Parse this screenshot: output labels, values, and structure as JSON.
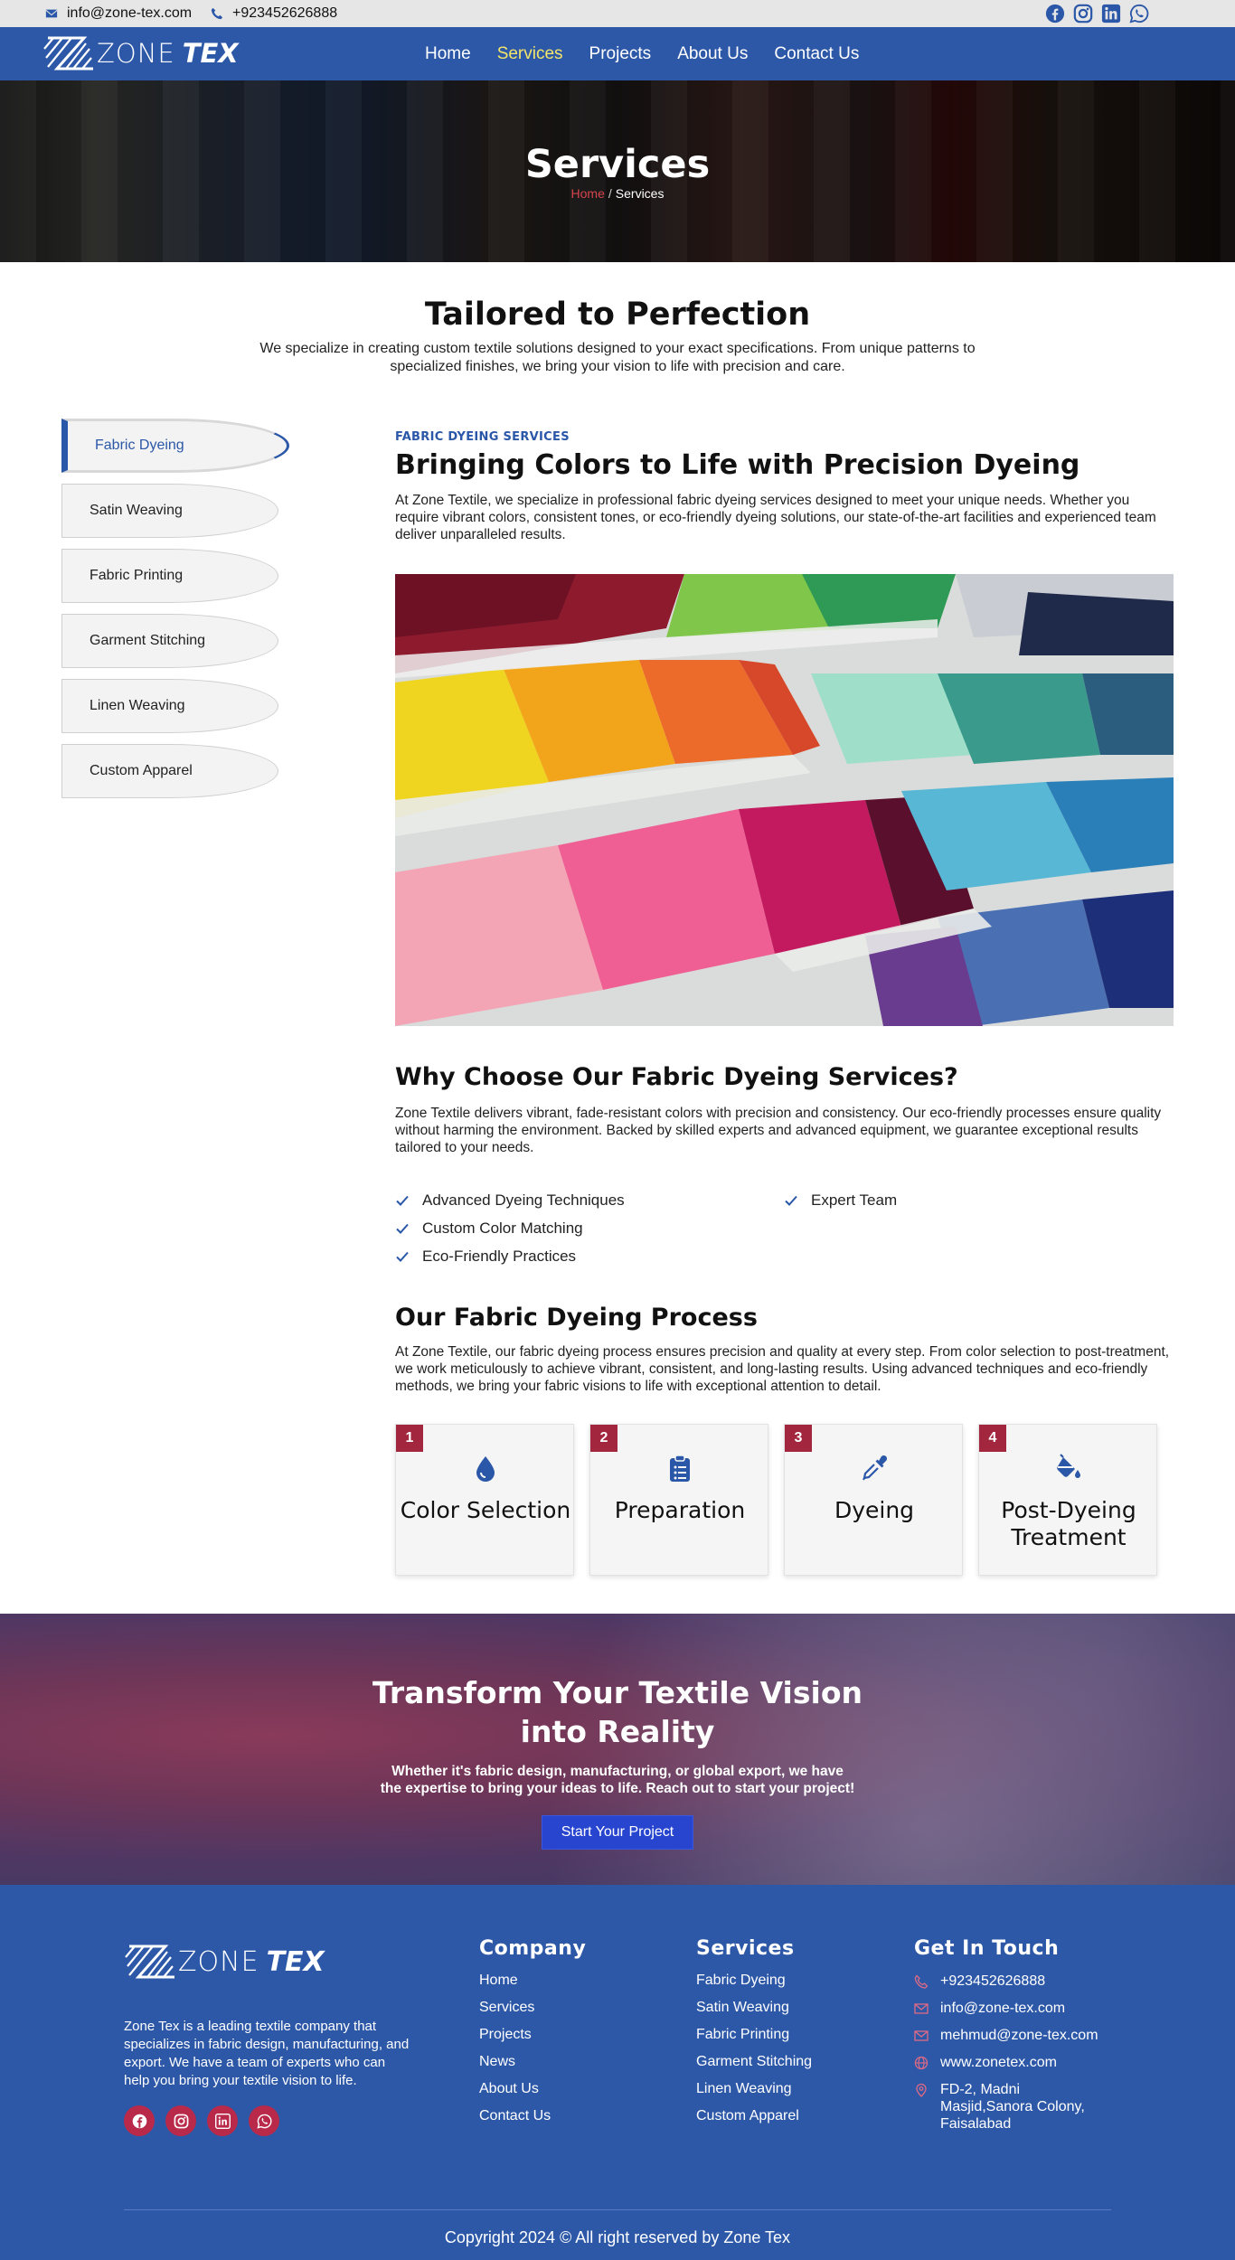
{
  "topbar": {
    "email": "info@zone-tex.com",
    "phone": "+923452626888",
    "social": [
      "facebook-icon",
      "instagram-icon",
      "linkedin-icon",
      "whatsapp-icon"
    ]
  },
  "brand": {
    "name_light": "ZONE",
    "name_bold": "TEX"
  },
  "nav": {
    "items": [
      "Home",
      "Services",
      "Projects",
      "About Us",
      "Contact Us"
    ],
    "active": "Services"
  },
  "hero": {
    "title": "Services",
    "breadcrumb_home": "Home",
    "breadcrumb_sep": "/",
    "breadcrumb_current": "Services"
  },
  "intro": {
    "title": "Tailored to Perfection",
    "text": "We specialize in creating custom textile solutions designed to your exact specifications. From unique patterns to specialized finishes, we bring your vision to life with precision and care."
  },
  "sidebar": {
    "items": [
      "Fabric Dyeing",
      "Satin Weaving",
      "Fabric Printing",
      "Garment Stitching",
      "Linen Weaving",
      "Custom Apparel"
    ],
    "active": "Fabric Dyeing"
  },
  "service": {
    "kicker": "FABRIC DYEING SERVICES",
    "title": "Bringing Colors to Life with Precision Dyeing",
    "text": "At Zone Textile, we specialize in professional fabric dyeing services designed to meet your unique needs. Whether you require vibrant colors, consistent tones, or eco-friendly dyeing solutions, our state-of-the-art facilities and experienced team deliver unparalleled results."
  },
  "why": {
    "title": "Why Choose Our Fabric Dyeing Services?",
    "text": "Zone Textile delivers vibrant, fade-resistant colors with precision and consistency. Our eco-friendly processes ensure quality without harming the environment. Backed by skilled experts and advanced equipment, we guarantee exceptional results tailored to your needs.",
    "features": [
      "Advanced Dyeing Techniques",
      "Custom Color Matching",
      "Eco-Friendly Practices",
      "Expert Team"
    ]
  },
  "process": {
    "title": "Our Fabric Dyeing Process",
    "text": "At Zone Textile, our fabric dyeing process ensures precision and quality at every step. From color selection to post-treatment, we work meticulously to achieve vibrant, consistent, and long-lasting results. Using advanced techniques and eco-friendly methods, we bring your fabric visions to life with exceptional attention to detail.",
    "steps": [
      {
        "num": "1",
        "label": "Color Selection",
        "icon": "droplet-icon"
      },
      {
        "num": "2",
        "label": "Preparation",
        "icon": "clipboard-list-icon"
      },
      {
        "num": "3",
        "label": "Dyeing",
        "icon": "eyedropper-icon"
      },
      {
        "num": "4",
        "label": "Post-Dyeing Treatment",
        "icon": "paint-bucket-icon"
      }
    ]
  },
  "cta": {
    "title": "Transform Your Textile Vision into Reality",
    "text": "Whether it's fabric design, manufacturing, or global export, we have the expertise to bring your ideas to life. Reach out to start your project!",
    "button": "Start Your Project"
  },
  "footer": {
    "about": "Zone Tex is a leading textile company that specializes in fabric design, manufacturing, and export. We have a team of experts who can help you bring your textile vision to life.",
    "company_title": "Company",
    "company_links": [
      "Home",
      "Services",
      "Projects",
      "News",
      "About Us",
      "Contact Us"
    ],
    "services_title": "Services",
    "services_links": [
      "Fabric Dyeing",
      "Satin Weaving",
      "Fabric Printing",
      "Garment Stitching",
      "Linen Weaving",
      "Custom Apparel"
    ],
    "contact_title": "Get In Touch",
    "phone": "+923452626888",
    "email1": "info@zone-tex.com",
    "email2": "mehmud@zone-tex.com",
    "website": "www.zonetex.com",
    "address": "FD-2, Madni Masjid,Sanora Colony, Faisalabad",
    "copyright": "Copyright 2024 © All right reserved by Zone Tex"
  },
  "colors": {
    "brand_blue": "#2d58a8",
    "accent_red": "#a3263f",
    "nav_active": "#f3e56a",
    "cta_button": "#2845cf"
  }
}
